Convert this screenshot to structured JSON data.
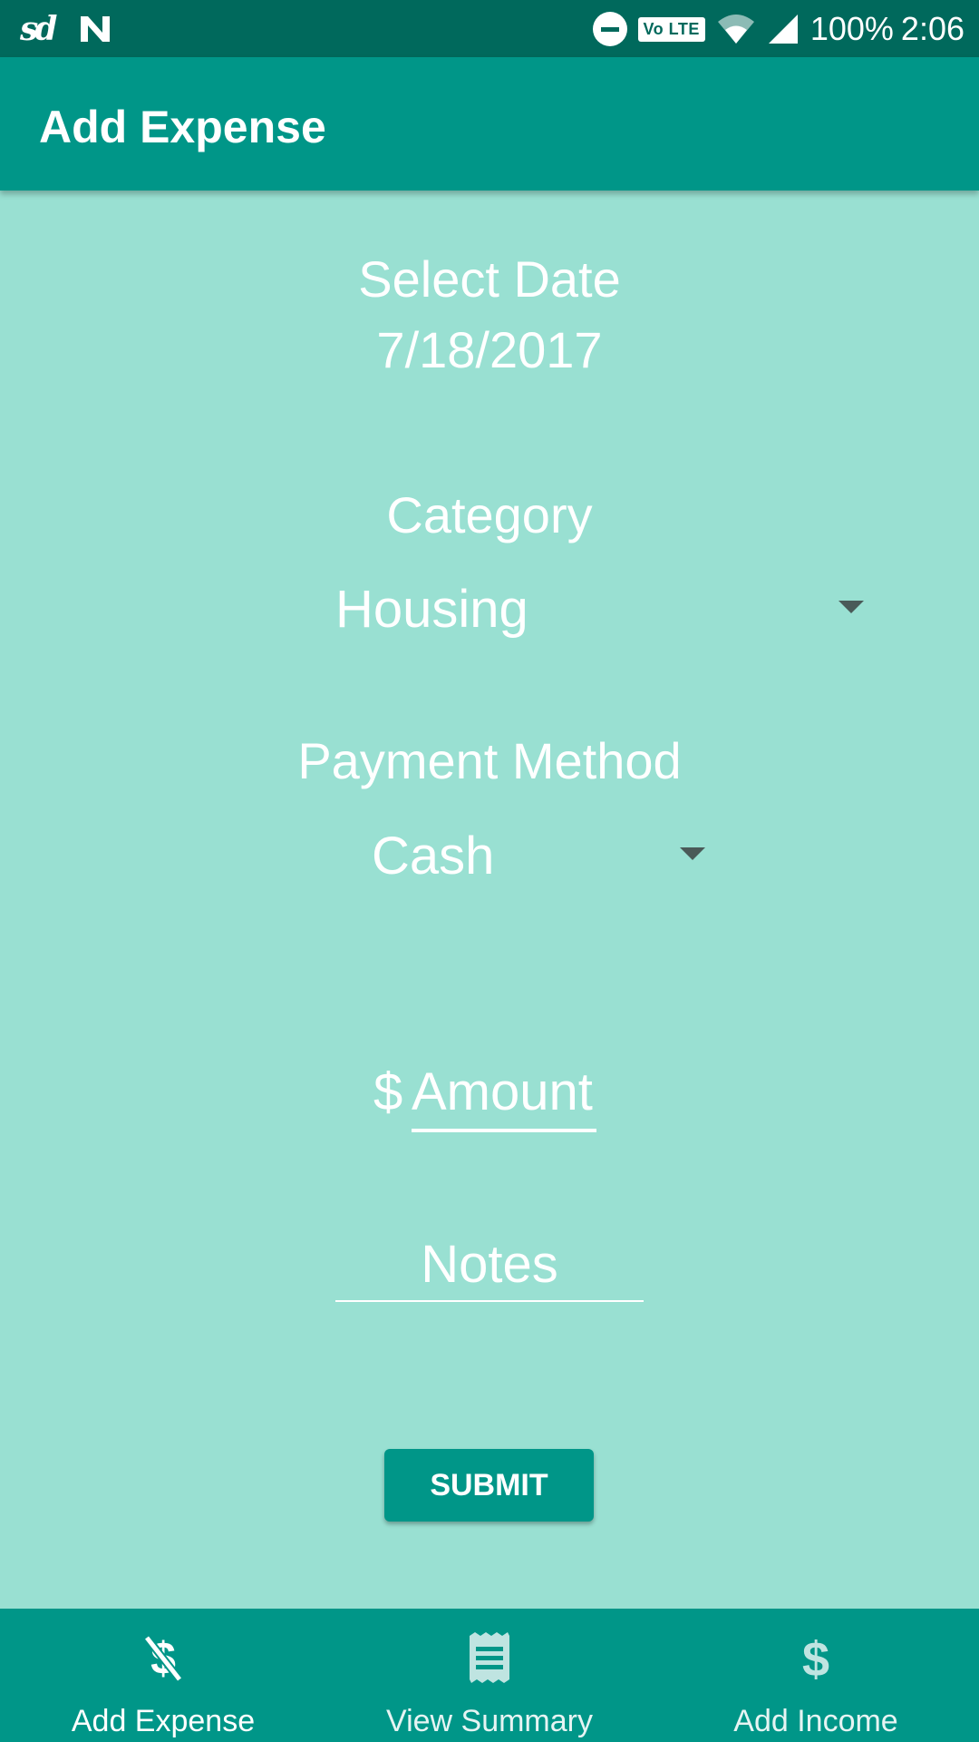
{
  "status_bar": {
    "sd_label": "sd",
    "volte_label": "Vo LTE",
    "battery": "100%",
    "time": "2:06"
  },
  "app_bar": {
    "title": "Add Expense"
  },
  "form": {
    "date_label": "Select Date",
    "date_value": "7/18/2017",
    "category_label": "Category",
    "category_value": "Housing",
    "payment_label": "Payment Method",
    "payment_value": "Cash",
    "currency_symbol": "$",
    "amount_placeholder": "Amount",
    "notes_placeholder": "Notes",
    "submit_label": "SUBMIT"
  },
  "bottom_nav": {
    "items": [
      {
        "label": "Add Expense",
        "icon": "no-dollar-icon"
      },
      {
        "label": "View Summary",
        "icon": "receipt-icon"
      },
      {
        "label": "Add Income",
        "icon": "dollar-icon"
      }
    ]
  },
  "colors": {
    "status_bar": "#00695c",
    "primary": "#009688",
    "background": "#99e0d2",
    "text": "#ffffff"
  }
}
